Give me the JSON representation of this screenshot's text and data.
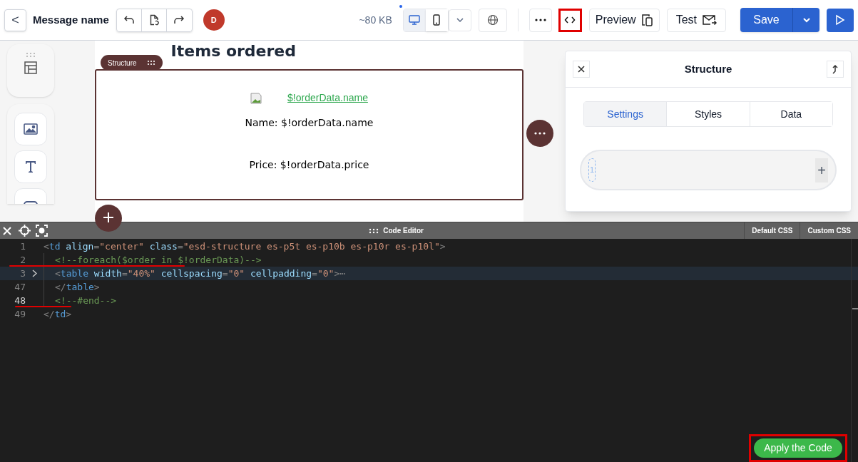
{
  "header": {
    "back": "<",
    "title": "Message name",
    "avatar": "D",
    "size": "~80 KB",
    "devices": [
      {
        "kind": "desktop",
        "selected": true
      },
      {
        "kind": "mobile",
        "selected": false
      }
    ],
    "preview": "Preview",
    "test": "Test",
    "save": "Save"
  },
  "canvas": {
    "heading": "Items ordered",
    "badge": "Structure",
    "link": "$!orderData.name",
    "lines": [
      "Name: $!orderData.name",
      "Price: $!orderData.price"
    ]
  },
  "panel": {
    "title": "Structure",
    "tabs": [
      {
        "label": "Settings",
        "selected": true
      },
      {
        "label": "Styles",
        "selected": false
      },
      {
        "label": "Data",
        "selected": false
      }
    ],
    "chip": "1",
    "add": "+"
  },
  "editor": {
    "title": "Code Editor",
    "buttons": [
      "Default CSS",
      "Custom CSS"
    ],
    "apply": "Apply the Code",
    "lines": [
      {
        "number": "1",
        "highlighted": false,
        "active": false,
        "folded": false,
        "tokens": [
          {
            "kind": "punct",
            "text": "<"
          },
          {
            "kind": "tag",
            "text": "td"
          },
          {
            "kind": "attr",
            "text": " align"
          },
          {
            "kind": "punct",
            "text": "="
          },
          {
            "kind": "str",
            "text": "\"center\""
          },
          {
            "kind": "attr",
            "text": " class"
          },
          {
            "kind": "punct",
            "text": "="
          },
          {
            "kind": "str",
            "text": "\"esd-structure es-p5t es-p10b es-p10r es-p10l\""
          },
          {
            "kind": "punct",
            "text": ">"
          }
        ],
        "children": [
          {
            "number": "2",
            "highlighted": false,
            "active": false,
            "folded": false,
            "tokens": [
              {
                "kind": "comment",
                "text": "<!--foreach($order in $!orderData)-->"
              }
            ]
          },
          {
            "number": "3",
            "highlighted": true,
            "active": false,
            "folded": true,
            "tokens": [
              {
                "kind": "punct",
                "text": "<"
              },
              {
                "kind": "tag",
                "text": "table"
              },
              {
                "kind": "attr",
                "text": " width"
              },
              {
                "kind": "punct",
                "text": "="
              },
              {
                "kind": "str",
                "text": "\"40%\""
              },
              {
                "kind": "attr",
                "text": " cellspacing"
              },
              {
                "kind": "punct",
                "text": "="
              },
              {
                "kind": "str",
                "text": "\"0\""
              },
              {
                "kind": "attr",
                "text": " cellpadding"
              },
              {
                "kind": "punct",
                "text": "="
              },
              {
                "kind": "str",
                "text": "\"0\""
              },
              {
                "kind": "punct",
                "text": ">"
              },
              {
                "kind": "punct",
                "text": "⋯"
              }
            ]
          },
          {
            "number": "47",
            "highlighted": false,
            "active": false,
            "folded": false,
            "tokens": [
              {
                "kind": "punct",
                "text": "</"
              },
              {
                "kind": "tag",
                "text": "table"
              },
              {
                "kind": "punct",
                "text": ">"
              }
            ]
          },
          {
            "number": "48",
            "highlighted": false,
            "active": true,
            "folded": false,
            "tokens": [
              {
                "kind": "comment",
                "text": "<!--#end-->"
              }
            ]
          }
        ]
      },
      {
        "number": "49",
        "highlighted": false,
        "active": false,
        "folded": false,
        "tokens": [
          {
            "kind": "punct",
            "text": "</"
          },
          {
            "kind": "tag",
            "text": "td"
          },
          {
            "kind": "punct",
            "text": ">"
          }
        ]
      }
    ]
  }
}
